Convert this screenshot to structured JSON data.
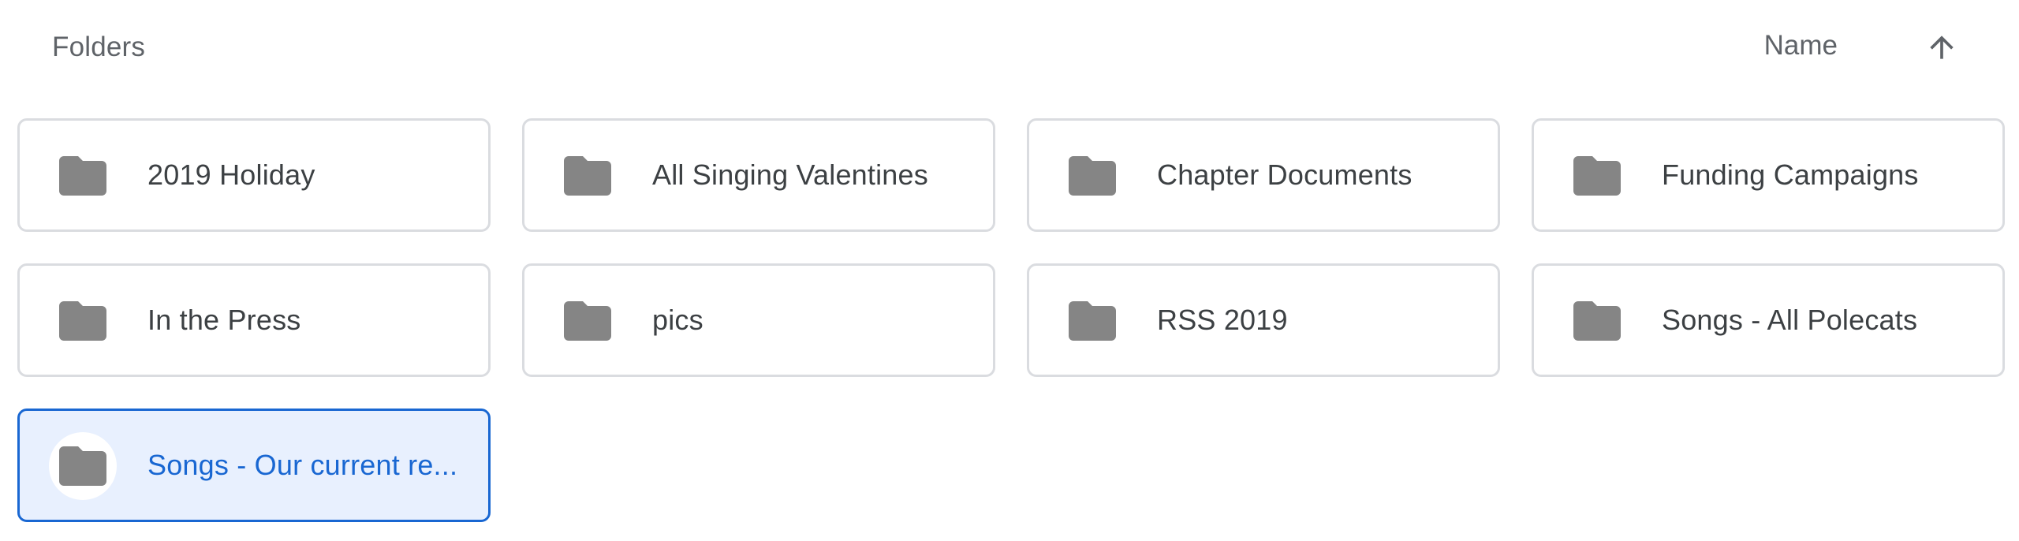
{
  "header": {
    "section_title": "Folders",
    "sort_label": "Name",
    "sort_direction_icon": "arrow-up-icon"
  },
  "colors": {
    "folder_icon": "#858585",
    "card_border": "#dadce0",
    "selected_background": "#e8f0fe",
    "selected_accent": "#1967d2",
    "text": "#3c4043",
    "muted_text": "#5f6368"
  },
  "folders": [
    {
      "name": "2019 Holiday",
      "icon": "folder-icon",
      "selected": false
    },
    {
      "name": "All Singing Valentines",
      "icon": "folder-icon",
      "selected": false
    },
    {
      "name": "Chapter Documents",
      "icon": "folder-icon",
      "selected": false
    },
    {
      "name": "Funding Campaigns",
      "icon": "folder-icon",
      "selected": false
    },
    {
      "name": "In the Press",
      "icon": "folder-icon",
      "selected": false
    },
    {
      "name": "pics",
      "icon": "folder-icon",
      "selected": false
    },
    {
      "name": "RSS 2019",
      "icon": "folder-icon",
      "selected": false
    },
    {
      "name": "Songs - All Polecats",
      "icon": "folder-icon",
      "selected": false
    },
    {
      "name": "Songs - Our current re...",
      "icon": "folder-icon",
      "selected": true
    }
  ]
}
